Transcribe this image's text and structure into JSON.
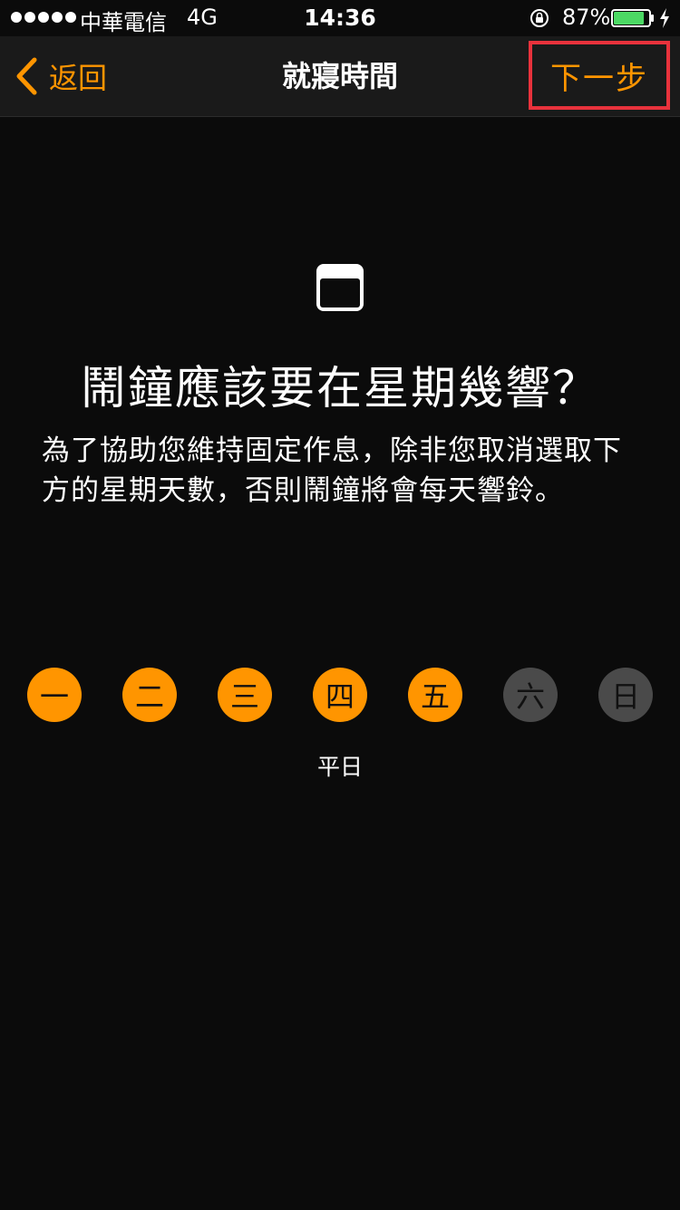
{
  "status_bar": {
    "carrier": "中華電信",
    "network": "4G",
    "time": "14:36",
    "battery_percent": "87%",
    "battery_level": 0.87,
    "signal_bars": 5
  },
  "nav": {
    "back_label": "返回",
    "title": "就寢時間",
    "next_label": "下一步"
  },
  "content": {
    "icon": "calendar-icon",
    "headline": "鬧鐘應該要在星期幾響？",
    "description": "為了協助您維持固定作息，除非您取消選取下方的星期天數，否則鬧鐘將會每天響鈴。"
  },
  "weekdays": {
    "days": [
      {
        "label": "一",
        "selected": true
      },
      {
        "label": "二",
        "selected": true
      },
      {
        "label": "三",
        "selected": true
      },
      {
        "label": "四",
        "selected": true
      },
      {
        "label": "五",
        "selected": true
      },
      {
        "label": "六",
        "selected": false
      },
      {
        "label": "日",
        "selected": false
      }
    ],
    "summary": "平日"
  },
  "colors": {
    "accent": "#ff9500",
    "background": "#0b0b0b",
    "nav_background": "#1a1a1a",
    "day_off": "#4a4a4a",
    "highlight_border": "#e8323c",
    "battery_fill": "#4cd964"
  }
}
